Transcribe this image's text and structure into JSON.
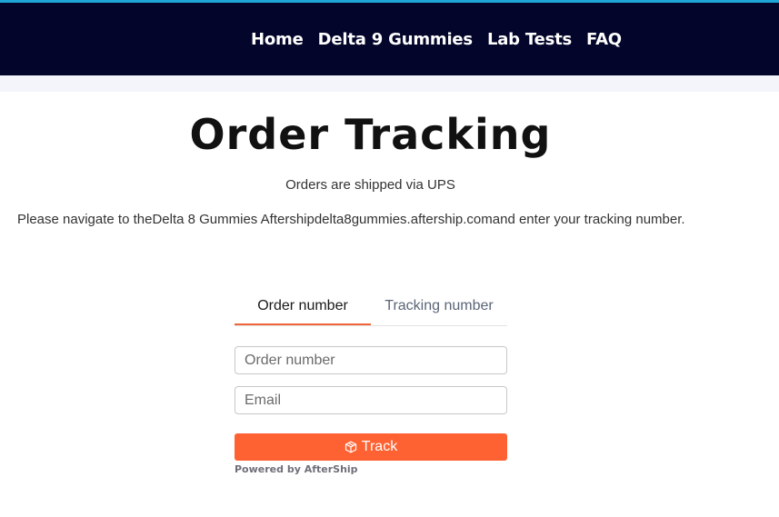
{
  "header": {
    "nav": [
      "Home",
      "Delta 9 Gummies",
      "Lab Tests",
      "FAQ"
    ]
  },
  "main": {
    "title": "Order Tracking",
    "shipped_text": "Orders are shipped via UPS",
    "navigate_text": "Please navigate to theDelta 8 Gummies Aftershipdelta8gummies.aftership.comand enter your tracking number."
  },
  "tracker": {
    "tabs": [
      "Order number",
      "Tracking number"
    ],
    "active_tab": "Order number",
    "order_placeholder": "Order number",
    "email_placeholder": "Email",
    "track_label": "Track",
    "powered_by": "Powered by AfterShip"
  },
  "colors": {
    "header_bg": "#03052a",
    "accent_top": "#1ea7d6",
    "button": "#fe6233",
    "tab_underline": "#f0653a"
  },
  "icons": {
    "track_button": "package-box-icon"
  }
}
